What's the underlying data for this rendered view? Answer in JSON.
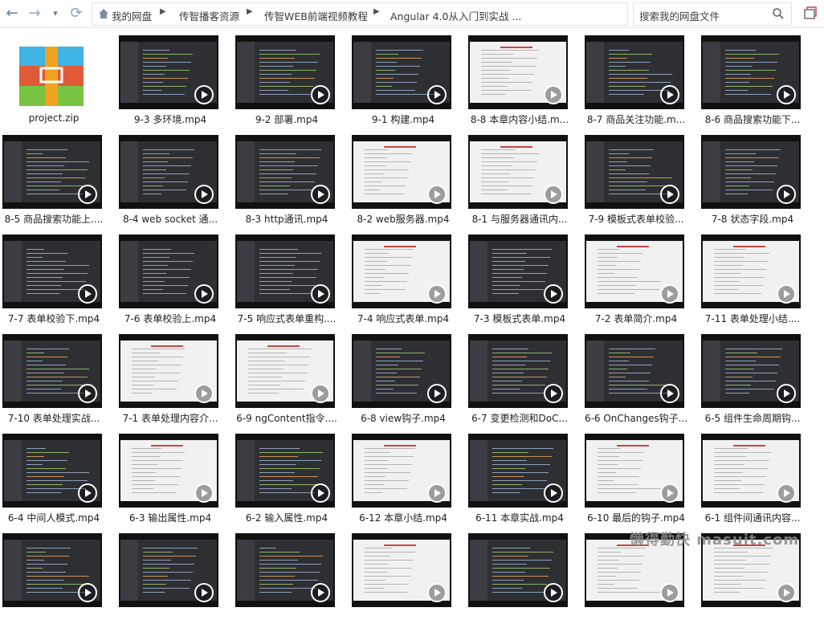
{
  "nav": {
    "back": "←",
    "forward": "→",
    "dropdown": "▾",
    "refresh": "⟳"
  },
  "breadcrumb": [
    "我的网盘",
    "传智播客资源",
    "传智WEB前端视频教程",
    "Angular 4.0从入门到实战 ..."
  ],
  "search": {
    "placeholder": "搜索我的网盘文件"
  },
  "files": [
    {
      "name": "project.zip",
      "kind": "zip"
    },
    {
      "name": "9-3 多环境.mp4",
      "kind": "code"
    },
    {
      "name": "9-2 部署.mp4",
      "kind": "code"
    },
    {
      "name": "9-1 构建.mp4",
      "kind": "code"
    },
    {
      "name": "8-8 本章内容小结.m...",
      "kind": "slide"
    },
    {
      "name": "8-7 商品关注功能.m...",
      "kind": "code"
    },
    {
      "name": "8-6 商品搜索功能下...",
      "kind": "code"
    },
    {
      "name": "8-5 商品搜索功能上....",
      "kind": "code"
    },
    {
      "name": "8-4 web socket 通...",
      "kind": "code"
    },
    {
      "name": "8-3 http通讯.mp4",
      "kind": "code"
    },
    {
      "name": "8-2 web服务器.mp4",
      "kind": "slide"
    },
    {
      "name": "8-1 与服务器通讯内...",
      "kind": "slide"
    },
    {
      "name": "7-9 模板式表单校验...",
      "kind": "code"
    },
    {
      "name": "7-8 状态字段.mp4",
      "kind": "code"
    },
    {
      "name": "7-7 表单校验下.mp4",
      "kind": "code"
    },
    {
      "name": "7-6 表单校验上.mp4",
      "kind": "code"
    },
    {
      "name": "7-5 响应式表单重构....",
      "kind": "code"
    },
    {
      "name": "7-4 响应式表单.mp4",
      "kind": "slide"
    },
    {
      "name": "7-3 模板式表单.mp4",
      "kind": "code"
    },
    {
      "name": "7-2 表单简介.mp4",
      "kind": "slide"
    },
    {
      "name": "7-11 表单处理小结....",
      "kind": "slide"
    },
    {
      "name": "7-10 表单处理实战...",
      "kind": "code"
    },
    {
      "name": "7-1 表单处理内容介...",
      "kind": "slide"
    },
    {
      "name": "6-9 ngContent指令....",
      "kind": "slide"
    },
    {
      "name": "6-8 view钩子.mp4",
      "kind": "code"
    },
    {
      "name": "6-7 变更检测和DoC...",
      "kind": "code"
    },
    {
      "name": "6-6 OnChanges钩子...",
      "kind": "code"
    },
    {
      "name": "6-5 组件生命周期钩...",
      "kind": "code"
    },
    {
      "name": "6-4 中间人模式.mp4",
      "kind": "code"
    },
    {
      "name": "6-3 输出属性.mp4",
      "kind": "slide"
    },
    {
      "name": "6-2 输入属性.mp4",
      "kind": "code"
    },
    {
      "name": "6-12 本章小结.mp4",
      "kind": "slide"
    },
    {
      "name": "6-11 本章实战.mp4",
      "kind": "code"
    },
    {
      "name": "6-10 最后的钩子.mp4",
      "kind": "slide"
    },
    {
      "name": "6-1 组件间通讯内容...",
      "kind": "slide"
    },
    {
      "name": "",
      "kind": "code"
    },
    {
      "name": "",
      "kind": "code"
    },
    {
      "name": "",
      "kind": "code"
    },
    {
      "name": "",
      "kind": "slide"
    },
    {
      "name": "",
      "kind": "code"
    },
    {
      "name": "",
      "kind": "slide"
    },
    {
      "name": "",
      "kind": "slide"
    }
  ],
  "watermark": "懒得勤快 masuit.com"
}
